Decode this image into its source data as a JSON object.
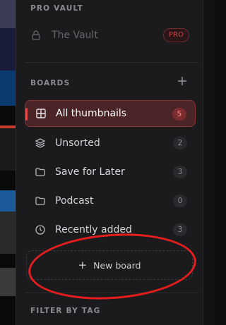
{
  "pro_vault": {
    "section_title": "PRO VAULT",
    "vault_label": "The Vault",
    "badge": "PRO"
  },
  "boards": {
    "section_title": "BOARDS",
    "add_icon": "plus-icon",
    "items": [
      {
        "label": "All thumbnails",
        "count": "5",
        "icon": "grid-icon",
        "active": true
      },
      {
        "label": "Unsorted",
        "count": "2",
        "icon": "layers-icon",
        "active": false
      },
      {
        "label": "Save for Later",
        "count": "3",
        "icon": "folder-icon",
        "active": false
      },
      {
        "label": "Podcast",
        "count": "0",
        "icon": "folder-icon",
        "active": false
      },
      {
        "label": "Recently added",
        "count": "3",
        "icon": "clock-icon",
        "active": false
      }
    ],
    "new_board_label": "New board"
  },
  "filter": {
    "section_title": "FILTER BY TAG"
  },
  "colors": {
    "accent": "#e24848",
    "annotation": "#e51d1d"
  }
}
